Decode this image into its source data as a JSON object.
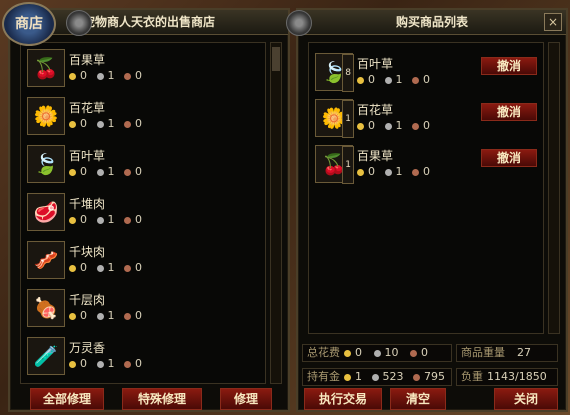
{
  "logo_text": "商店",
  "left": {
    "title": "宠物商人天衣的出售商店",
    "items": [
      {
        "name": "百果草",
        "gold": "0",
        "silver": "1",
        "copper": "0",
        "icon": "fruit-herb-icon"
      },
      {
        "name": "百花草",
        "gold": "0",
        "silver": "1",
        "copper": "0",
        "icon": "flower-herb-icon"
      },
      {
        "name": "百叶草",
        "gold": "0",
        "silver": "1",
        "copper": "0",
        "icon": "leaf-herb-icon"
      },
      {
        "name": "千堆肉",
        "gold": "0",
        "silver": "1",
        "copper": "0",
        "icon": "meat-slab-icon"
      },
      {
        "name": "千块肉",
        "gold": "0",
        "silver": "1",
        "copper": "0",
        "icon": "meat-chunk-icon"
      },
      {
        "name": "千层肉",
        "gold": "0",
        "silver": "1",
        "copper": "0",
        "icon": "meat-layer-icon"
      },
      {
        "name": "万灵香",
        "gold": "0",
        "silver": "1",
        "copper": "0",
        "icon": "incense-bottle-icon"
      }
    ],
    "btn_repair_all": "全部修理",
    "btn_special_repair": "特殊修理",
    "btn_repair": "修理"
  },
  "right": {
    "title": "购买商品列表",
    "items": [
      {
        "name": "百叶草",
        "gold": "0",
        "silver": "1",
        "copper": "0",
        "count": "8",
        "cancel": "撤消"
      },
      {
        "name": "百花草",
        "gold": "0",
        "silver": "1",
        "copper": "0",
        "count": "1",
        "cancel": "撤消"
      },
      {
        "name": "百果草",
        "gold": "0",
        "silver": "1",
        "copper": "0",
        "count": "1",
        "cancel": "撤消"
      }
    ],
    "cost_label": "总花费",
    "cost_gold": "0",
    "cost_silver": "10",
    "cost_copper": "0",
    "weight_label": "商品重量",
    "weight_value": "27",
    "money_label": "持有金",
    "money_gold": "1",
    "money_silver": "523",
    "money_copper": "795",
    "load_label": "负重",
    "load_value": "1143/1850",
    "btn_execute": "执行交易",
    "btn_clear": "清空",
    "btn_close": "关闭"
  },
  "close_glyph": "×"
}
